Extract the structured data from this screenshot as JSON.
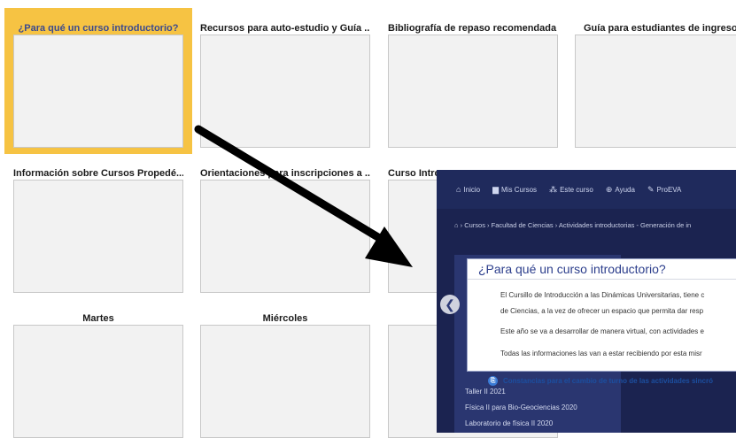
{
  "tiles_row1": [
    {
      "title": "¿Para qué un curso introductorio?"
    },
    {
      "title": "Recursos para auto-estudio y Guía ..."
    },
    {
      "title": "Bibliografía de repaso recomendada"
    },
    {
      "title": "Guía para estudiantes de ingreso"
    }
  ],
  "tiles_row2": [
    {
      "title": "Información sobre Cursos Propedé..."
    },
    {
      "title": "Orientaciones para inscripciones a ..."
    },
    {
      "title": "Curso Intro..."
    }
  ],
  "tiles_row3": [
    {
      "title": "Martes"
    },
    {
      "title": "Miércoles"
    },
    {
      "title": ""
    }
  ],
  "screenshot": {
    "nav": [
      {
        "label": "Inicio",
        "icon": "home-icon"
      },
      {
        "label": "Mis Cursos",
        "icon": "briefcase-icon"
      },
      {
        "label": "Este curso",
        "icon": "sitemap-icon"
      },
      {
        "label": "Ayuda",
        "icon": "lifebuoy-icon"
      },
      {
        "label": "ProEVA",
        "icon": "wrench-icon"
      }
    ],
    "breadcrumb": "› Cursos › Facultad de Ciencias › Actividades introductorias - Generación de in",
    "left_items": [
      "Taller II 2021",
      "Física II para Bio-Geociencias 2020",
      "Laboratorio de física II 2020"
    ],
    "modal": {
      "title": "¿Para qué un curso introductorio?",
      "lines": [
        "El Cursillo de Introducción a las Dinámicas Universitarias, tiene c",
        "de Ciencias, a la vez de ofrecer un espacio que permita dar resp",
        "Este año se va a desarrollar de manera virtual, con actividades e",
        "Todas las informaciones las van a estar recibiendo por esta misr"
      ],
      "link": "Constancias para el cambio de turno de las actividades sincró"
    }
  },
  "colors": {
    "highlight": "#f6c343",
    "nav_bg": "#1f2a5c",
    "modal_title": "#2c3e8c"
  }
}
